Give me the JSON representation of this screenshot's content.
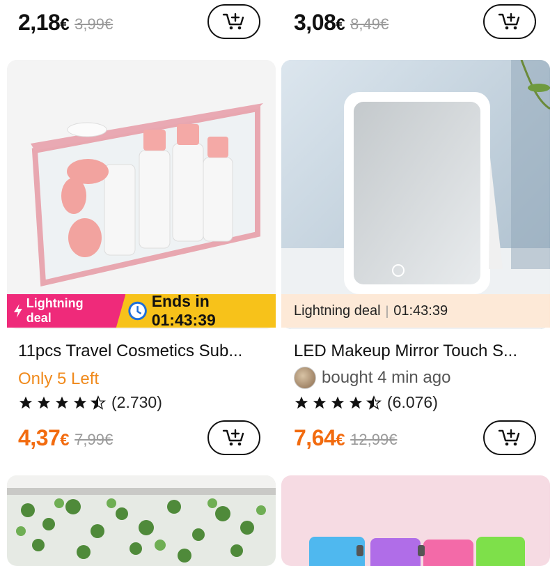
{
  "top_row": {
    "left": {
      "price": "2,18",
      "currency": "€",
      "old_price": "3,99€"
    },
    "right": {
      "price": "3,08",
      "currency": "€",
      "old_price": "8,49€"
    }
  },
  "products": [
    {
      "deal_label": "Lightning deal",
      "deal_ends": "Ends in 01:43:39",
      "title": "11pcs Travel Cosmetics Sub...",
      "stock": "Only 5 Left",
      "rating_count": "(2.730)",
      "rating": 4.5,
      "price": "4,37",
      "currency": "€",
      "old_price": "7,99€"
    },
    {
      "deal_label": "Lightning deal",
      "deal_time": "01:43:39",
      "title": "LED Makeup Mirror Touch S...",
      "bought": "bought 4 min ago",
      "rating_count": "(6.076)",
      "rating": 4.5,
      "price": "7,64",
      "currency": "€",
      "old_price": "12,99€"
    }
  ],
  "colors": {
    "accent": "#f26b0f",
    "deal_yellow": "#f7c21a",
    "deal_pink": "#ef2a7a",
    "deal_light": "#fde9d7"
  },
  "icons": [
    "add-to-cart-icon",
    "lightning-icon",
    "star-icon"
  ]
}
